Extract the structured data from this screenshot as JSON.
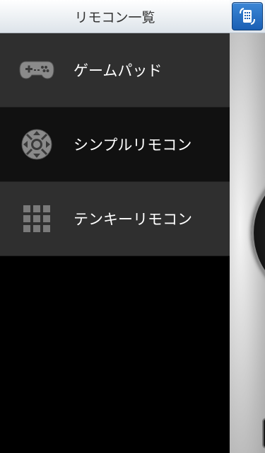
{
  "drawer": {
    "title": "リモコン一覧",
    "items": [
      {
        "label": "ゲームパッド",
        "icon": "gamepad-icon",
        "selected": false
      },
      {
        "label": "シンプルリモコン",
        "icon": "dpad-icon",
        "selected": true
      },
      {
        "label": "テンキーリモコン",
        "icon": "numpad-icon",
        "selected": false
      }
    ]
  },
  "main": {
    "toggle_icon": "keypad-icon",
    "accent_color": "#1a5fb4"
  }
}
